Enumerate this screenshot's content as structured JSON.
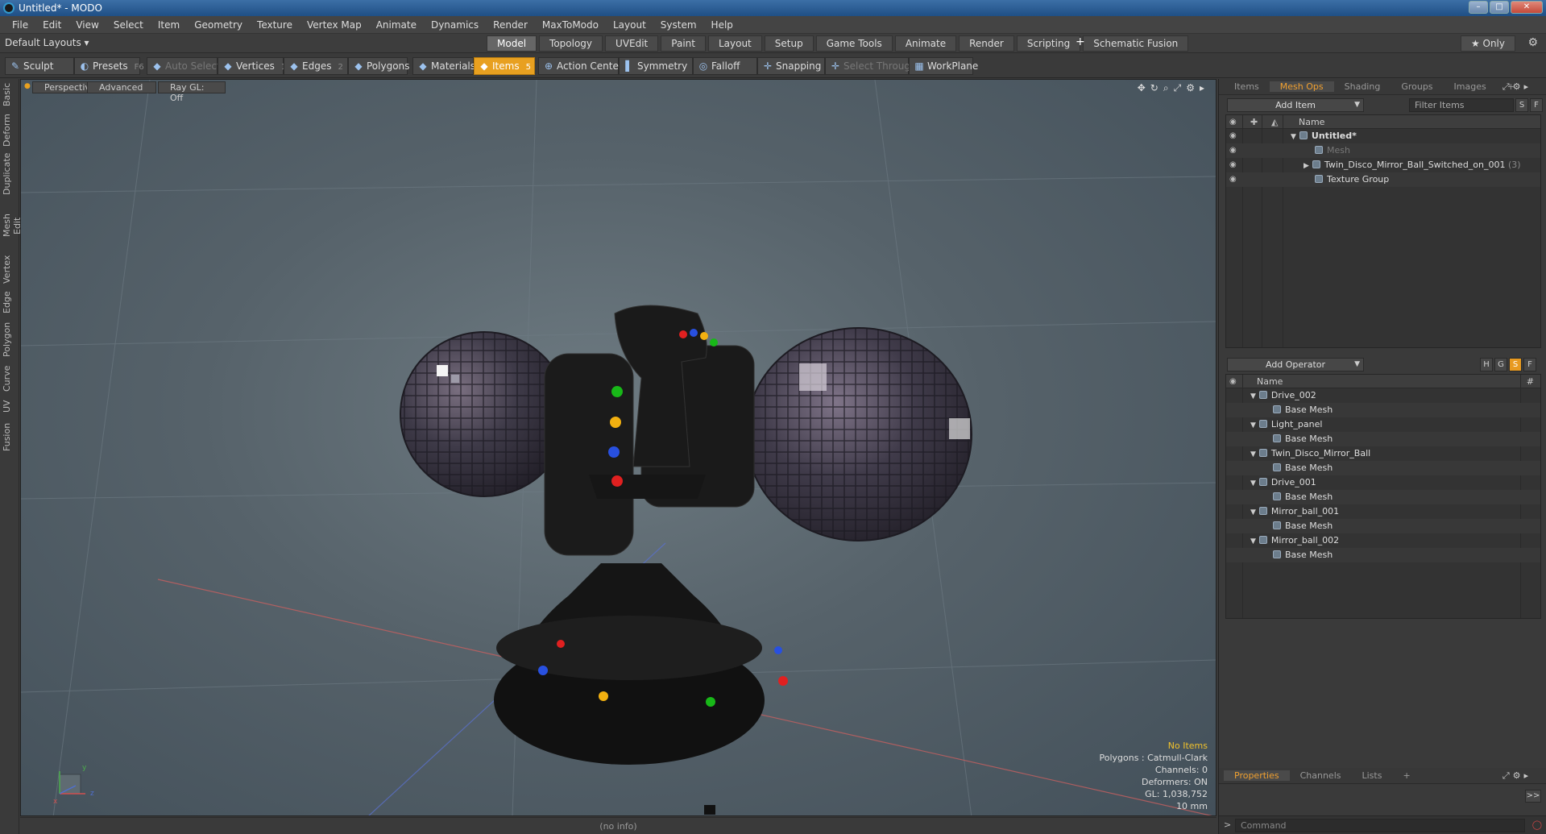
{
  "window": {
    "title": "Untitled* - MODO",
    "buttons": [
      "–",
      "□",
      "✕"
    ]
  },
  "menu": [
    "File",
    "Edit",
    "View",
    "Select",
    "Item",
    "Geometry",
    "Texture",
    "Vertex Map",
    "Animate",
    "Dynamics",
    "Render",
    "MaxToModo",
    "Layout",
    "System",
    "Help"
  ],
  "layout": {
    "selector": "Default Layouts ▾",
    "tabs": [
      "Model",
      "Topology",
      "UVEdit",
      "Paint",
      "Layout",
      "Setup",
      "Game Tools",
      "Animate",
      "Render",
      "Scripting",
      "Schematic Fusion"
    ],
    "active_tab": "Model",
    "add_tab": "+",
    "only_label": "★ Only",
    "gear": "⚙"
  },
  "toolbar": {
    "sculpt": "Sculpt",
    "presets": "Presets",
    "presets_key": "F6",
    "auto_select": "Auto Select",
    "vertices": "Vertices",
    "vertices_key": "1",
    "edges": "Edges",
    "edges_key": "2",
    "polygons": "Polygons",
    "materials": "Materials",
    "items": "Items",
    "items_key": "5",
    "action_center": "Action Center",
    "symmetry": "Symmetry",
    "falloff": "Falloff",
    "snapping": "Snapping",
    "select_through": "Select Through",
    "workplane": "WorkPlane"
  },
  "left_tabs": [
    "Basic",
    "Deform",
    "Duplicate",
    "Mesh Edit",
    "Vertex",
    "Edge",
    "Polygon",
    "Curve",
    "UV",
    "Fusion"
  ],
  "viewport": {
    "perspective": "Perspective",
    "advanced": "Advanced",
    "raygl": "Ray GL: Off",
    "icons": [
      "✥",
      "↻",
      "⌕",
      "⤢",
      "⚙",
      "▸"
    ],
    "info": {
      "no_items": "No Items",
      "polygons": "Polygons : Catmull-Clark",
      "channels": "Channels: 0",
      "deformers": "Deformers: ON",
      "gl": "GL: 1,038,752",
      "scale": "10 mm"
    },
    "axis": {
      "x": "x",
      "y": "y",
      "z": "z"
    }
  },
  "status": "(no info)",
  "items_panel": {
    "tabs": [
      "Items",
      "Mesh Ops",
      "Shading",
      "Groups",
      "Images",
      "+"
    ],
    "active_tab": "Mesh Ops",
    "add_item": "Add Item",
    "filter_placeholder": "Filter Items",
    "s": "S",
    "f": "F",
    "header": "Name",
    "rows": [
      {
        "label": "Untitled*",
        "indent": 0,
        "expanded": true
      },
      {
        "label": "Mesh",
        "indent": 1,
        "dim": true
      },
      {
        "label": "Twin_Disco_Mirror_Ball_Switched_on_001",
        "count": "(3)",
        "indent": 1,
        "collapsed": true
      },
      {
        "label": "Texture Group",
        "indent": 1
      }
    ]
  },
  "ops_panel": {
    "add_operator": "Add Operator",
    "h": "H",
    "g": "G",
    "s": "S",
    "f": "F",
    "header": "Name",
    "hash": "#",
    "rows": [
      {
        "label": "Drive_002",
        "child": "Base Mesh"
      },
      {
        "label": "Light_panel",
        "child": "Base Mesh"
      },
      {
        "label": "Twin_Disco_Mirror_Ball",
        "child": "Base Mesh"
      },
      {
        "label": "Drive_001",
        "child": "Base Mesh"
      },
      {
        "label": "Mirror_ball_001",
        "child": "Base Mesh"
      },
      {
        "label": "Mirror_ball_002",
        "child": "Base Mesh"
      }
    ]
  },
  "props_panel": {
    "tabs": [
      "Properties",
      "Channels",
      "Lists",
      "+"
    ],
    "active_tab": "Properties",
    "expand": ">>",
    "command_placeholder": "Command"
  },
  "colors": {
    "accent": "#e8a020",
    "active_tab_text": "#f0a030",
    "viewport_bg": "#5a666e"
  }
}
